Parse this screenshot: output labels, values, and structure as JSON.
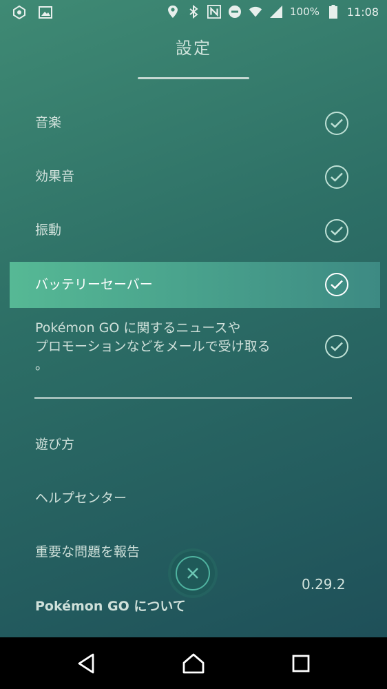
{
  "status_bar": {
    "battery_percent": "100%",
    "time": "11:08",
    "icons": [
      "app-icon",
      "image-icon",
      "location-icon",
      "bluetooth-icon",
      "nfc-icon",
      "do-not-disturb-icon",
      "wifi-icon",
      "signal-icon",
      "battery-icon"
    ]
  },
  "header": {
    "title": "設定"
  },
  "settings": [
    {
      "label": "音楽",
      "checked": true
    },
    {
      "label": "効果音",
      "checked": true
    },
    {
      "label": "振動",
      "checked": true
    },
    {
      "label": "バッテリーセーバー",
      "checked": true,
      "highlighted": true
    },
    {
      "label_lines": [
        "Pokémon GO に関するニュースや",
        "プロモーションなどをメールで受け取る",
        "。"
      ],
      "checked": true
    }
  ],
  "menu": {
    "how_to_play": "遊び方",
    "help_center": "ヘルプセンター",
    "report_issue": "重要な問題を報告",
    "about": "Pokémon GO について"
  },
  "version": "0.29.2",
  "colors": {
    "bg_top": "#3f8a74",
    "bg_bottom": "#1d4c57",
    "highlight_start": "#56b995",
    "highlight_end": "#3d8a83",
    "check_color": "#bfe1d6",
    "close_ring": "#4fb3a0"
  },
  "nav_bar": {
    "icons": [
      "back-icon",
      "home-icon",
      "recents-icon"
    ]
  }
}
